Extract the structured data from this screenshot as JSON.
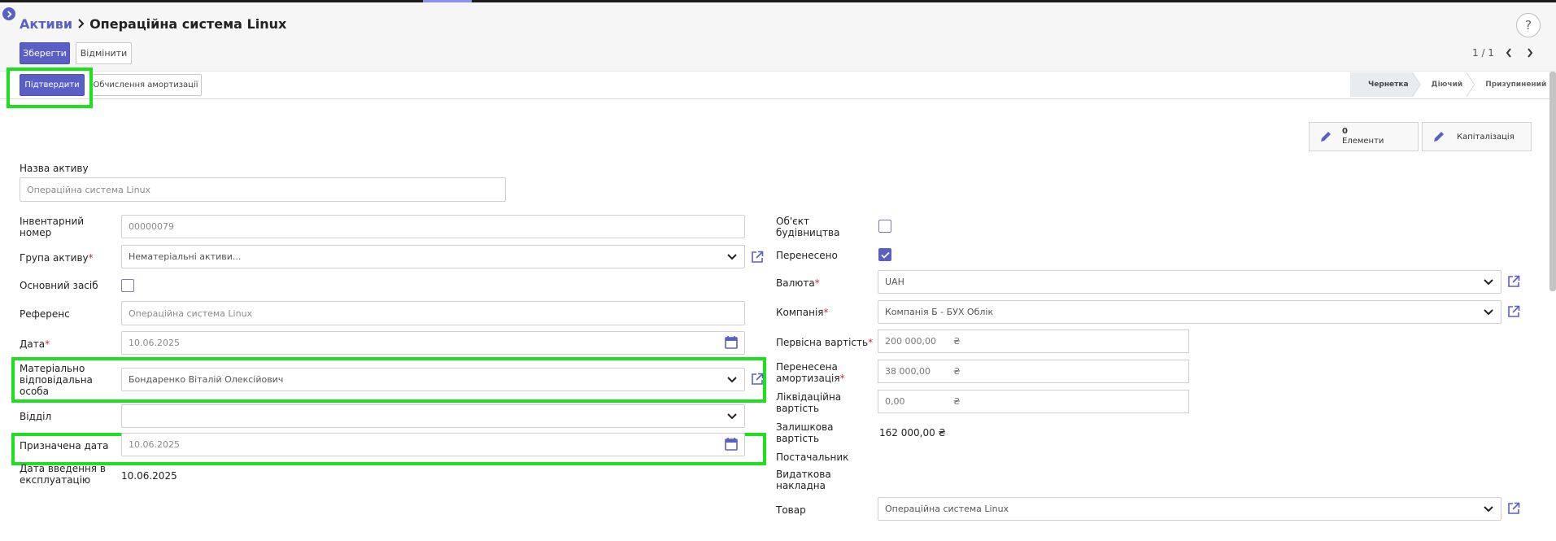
{
  "header": {
    "breadcrumb_root": "Активи",
    "breadcrumb_current": "Операційна система Linux",
    "save_label": "Зберегти",
    "discard_label": "Відмінити",
    "pager_text": "1 / 1",
    "help_label": "?"
  },
  "statusbar": {
    "confirm_label": "Підтвердити",
    "compute_label": "Обчислення амортизації",
    "stages": [
      "Чернетка",
      "Діючий",
      "Призупинений"
    ],
    "active_stage": "Чернетка"
  },
  "smart_buttons": {
    "items_count": "0",
    "items_label": "Елементи",
    "capitalization_label": "Капіталізація"
  },
  "form": {
    "name_label": "Назва активу",
    "name_value": "Операційна система Linux",
    "left": {
      "inventory_label": "Інвентарний номер",
      "inventory_value": "00000079",
      "group_label": "Група активу",
      "group_value": "Нематеріальні активи...",
      "fixed_asset_label": "Основний засіб",
      "reference_label": "Референс",
      "reference_value": "Операційна система Linux",
      "date_label": "Дата",
      "date_value": "10.06.2025",
      "responsible_label": "Матеріально відповідальна особа",
      "responsible_value": "Бондаренко Віталій Олексійович",
      "department_label": "Відділ",
      "department_value": "",
      "assigned_date_label": "Призначена дата",
      "assigned_date_value": "10.06.2025",
      "commission_date_label": "Дата введення в експлуатацію",
      "commission_date_value": "10.06.2025"
    },
    "right": {
      "construction_label": "Об'єкт будівництва",
      "transferred_label": "Перенесено",
      "currency_label": "Валюта",
      "currency_value": "UAH",
      "company_label": "Компанія",
      "company_value": "Компанія Б - БУХ Облік",
      "initial_cost_label": "Первісна вартість",
      "initial_cost_value": "200 000,00",
      "transferred_dep_label": "Перенесена амортизація",
      "transferred_dep_value": "38 000,00",
      "salvage_label": "Ліквідаційна вартість",
      "salvage_value": "0,00",
      "residual_label": "Залишкова вартість",
      "residual_value": "162 000,00 ₴",
      "supplier_label": "Постачальник",
      "invoice_label": "Видаткова накладна",
      "product_label": "Товар",
      "product_value": "Операційна система Linux",
      "currency_symbol": "₴"
    },
    "state": {
      "fixed_asset_checked": false,
      "construction_checked": false,
      "transferred_checked": true
    }
  },
  "colors": {
    "accent": "#5a5fc6",
    "highlight": "#1fe01f",
    "required": "#d02d2d"
  }
}
